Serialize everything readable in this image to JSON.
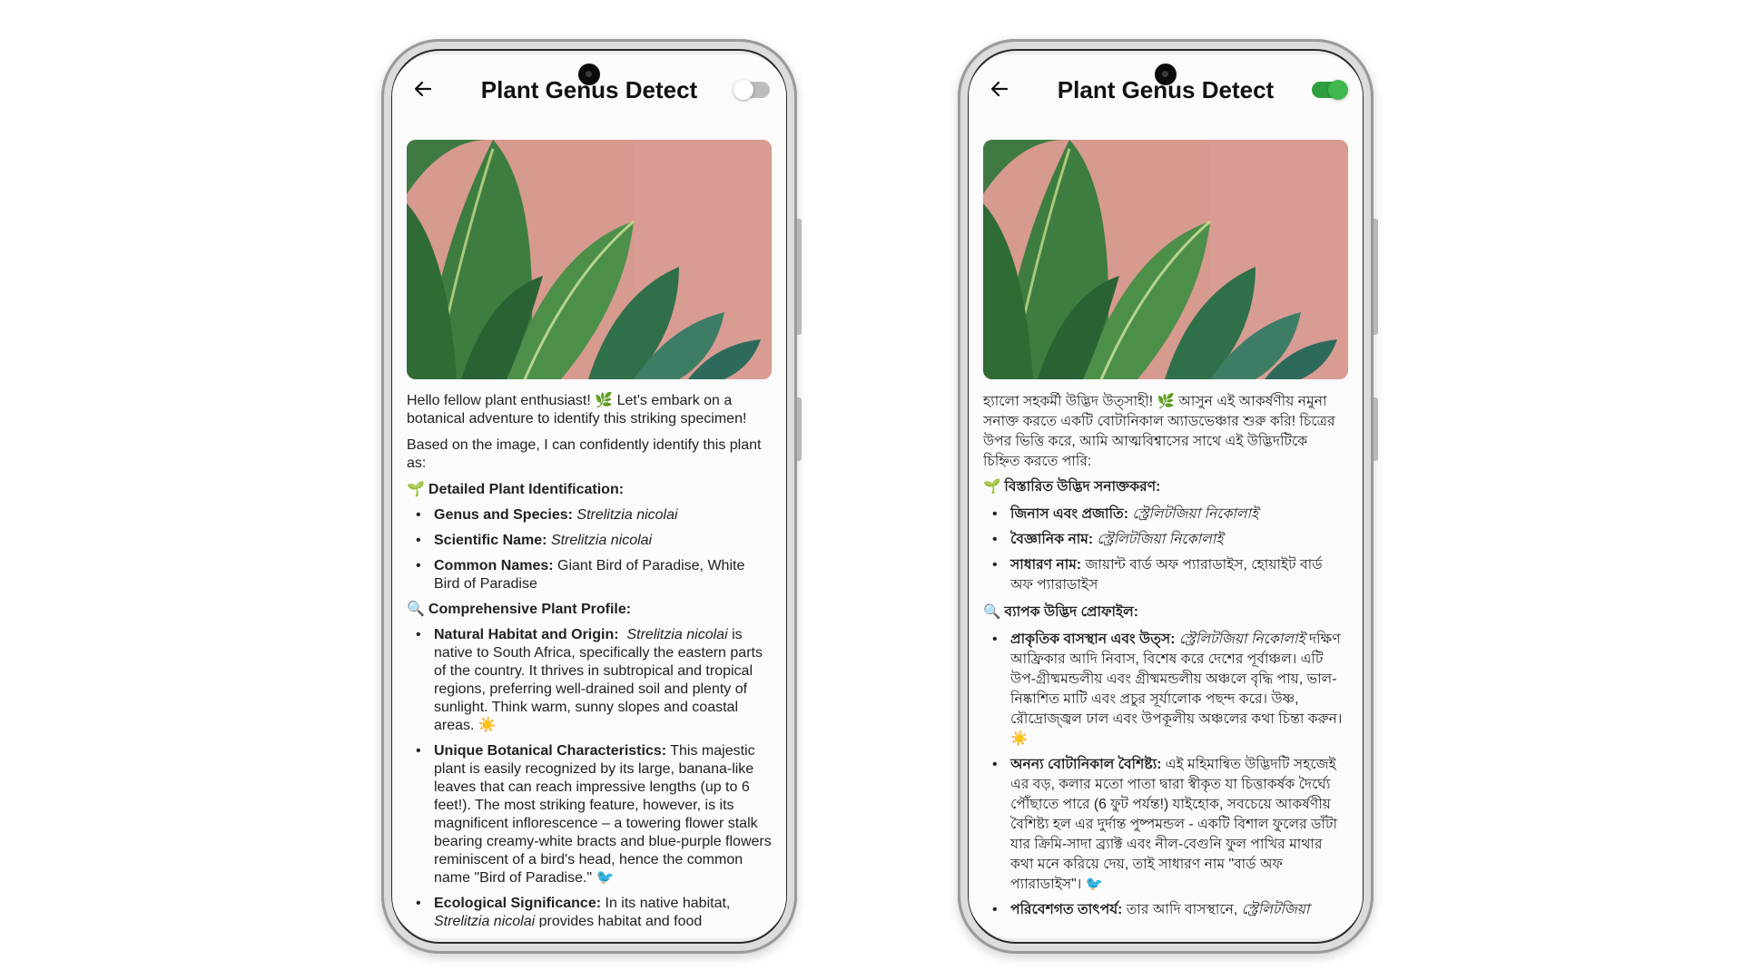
{
  "app": {
    "title": "Plant Genus Detect"
  },
  "icons": {
    "back": "arrow-left-icon",
    "toggle": "language-toggle"
  },
  "colors": {
    "toggle_on": "#2e9e3e",
    "toggle_off": "#bdbdbd",
    "photo_wall": "#d69a8f"
  },
  "english": {
    "toggle_state": "off",
    "intro": "Hello fellow plant enthusiast! 🌿 Let's embark on a botanical adventure to identify this striking specimen!",
    "based_on": "Based on the image, I can confidently identify this plant as:",
    "section1": {
      "emoji": "🌱",
      "title": "Detailed Plant Identification:"
    },
    "genus_label": "Genus and Species:",
    "genus_value": "Strelitzia nicolai",
    "sci_label": "Scientific Name:",
    "sci_value": "Strelitzia nicolai",
    "common_label": "Common Names:",
    "common_value": " Giant Bird of Paradise, White Bird of Paradise",
    "section2": {
      "emoji": "🔍",
      "title": "Comprehensive Plant Profile:"
    },
    "habitat_label": "Natural Habitat and Origin:",
    "habitat_species": "Strelitzia nicolai",
    "habitat_text": " is native to South Africa, specifically the eastern parts of the country.  It thrives in subtropical and tropical regions, preferring well-drained soil and plenty of sunlight.  Think warm, sunny slopes and coastal areas. ",
    "habitat_emoji": "☀️",
    "unique_label": "Unique Botanical Characteristics:",
    "unique_text": " This majestic plant is easily recognized by its large, banana-like leaves that can reach impressive lengths (up to 6 feet!).  The most striking feature, however, is its magnificent inflorescence – a towering flower stalk bearing creamy-white bracts and blue-purple flowers reminiscent of a bird's head, hence the common name \"Bird of Paradise.\" ",
    "unique_emoji": "🐦",
    "eco_label": "Ecological Significance:",
    "eco_text": "  In its native habitat, ",
    "eco_species": "Strelitzia nicolai",
    "eco_text2": " provides habitat and food"
  },
  "bengali": {
    "toggle_state": "on",
    "intro_part1": "হ্যালো সহকর্মী উদ্ভিদ উত্সাহী! ",
    "intro_emoji": "🌿",
    "intro_part2": " আসুন এই আকর্ষণীয় নমুনা সনাক্ত করতে একটি বোটানিকাল অ্যাডভেঞ্চার শুরু করি! চিত্রের উপর ভিত্তি করে, আমি আত্মবিশ্বাসের সাথে এই উদ্ভিদটিকে চিহ্নিত করতে পারি:",
    "section1": {
      "emoji": "🌱",
      "title": "বিস্তারিত উদ্ভিদ সনাক্তকরণ:"
    },
    "genus_label": "জিনাস এবং প্রজাতি:",
    "genus_value": " স্ট্রেলিটজিয়া নিকোলাই",
    "sci_label": "বৈজ্ঞানিক নাম:",
    "sci_value": " স্ট্রেলিটজিয়া নিকোলাই",
    "common_label": "সাধারণ নাম:",
    "common_value": "  জায়ান্ট বার্ড অফ প্যারাডাইস, হোয়াইট বার্ড অফ প্যারাডাইস",
    "section2": {
      "emoji": "🔍",
      "title": "ব্যাপক উদ্ভিদ প্রোফাইল:"
    },
    "habitat_label": "প্রাকৃতিক বাসস্থান এবং উত্স:",
    "habitat_species": "  স্ট্রেলিটজিয়া নিকোলাই",
    "habitat_text": " দক্ষিণ আফ্রিকার আদি নিবাস, বিশেষ করে দেশের পূর্বাঞ্চল। এটি উপ-গ্রীষ্মমন্ডলীয় এবং গ্রীষ্মমন্ডলীয় অঞ্চলে বৃদ্ধি পায়, ভাল-নিষ্কাশিত মাটি এবং প্রচুর সূর্যালোক পছন্দ করে। উষ্ণ, রৌদ্রোজ্জ্বল ঢাল এবং উপকূলীয় অঞ্চলের কথা চিন্তা করুন। ",
    "habitat_emoji": "☀️",
    "unique_label": "অনন্য বোটানিকাল বৈশিষ্ট্য:",
    "unique_text": " এই মহিমান্বিত উদ্ভিদটি সহজেই এর বড়, কলার মতো পাতা দ্বারা স্বীকৃত যা চিত্তাকর্ষক দৈর্ঘ্যে পৌঁছাতে পারে (6 ফুট পর্যন্ত!) যাইহোক, সবচেয়ে আকর্ষণীয় বৈশিষ্ট্য হল এর দুর্দান্ত পুষ্পমন্ডল - একটি বিশাল ফুলের ডাঁটা যার ক্রিমি-সাদা ব্র্যাক্ট এবং নীল-বেগুনি ফুল পাখির মাথার কথা মনে করিয়ে দেয়, তাই সাধারণ নাম \"বার্ড অফ প্যারাডাইস\"। ",
    "unique_emoji": "🐦",
    "eco_label": "পরিবেশগত তাৎপর্য:",
    "eco_text": "  তার আদি বাসস্থানে, ",
    "eco_species": "স্ট্রেলিটজিয়া"
  }
}
